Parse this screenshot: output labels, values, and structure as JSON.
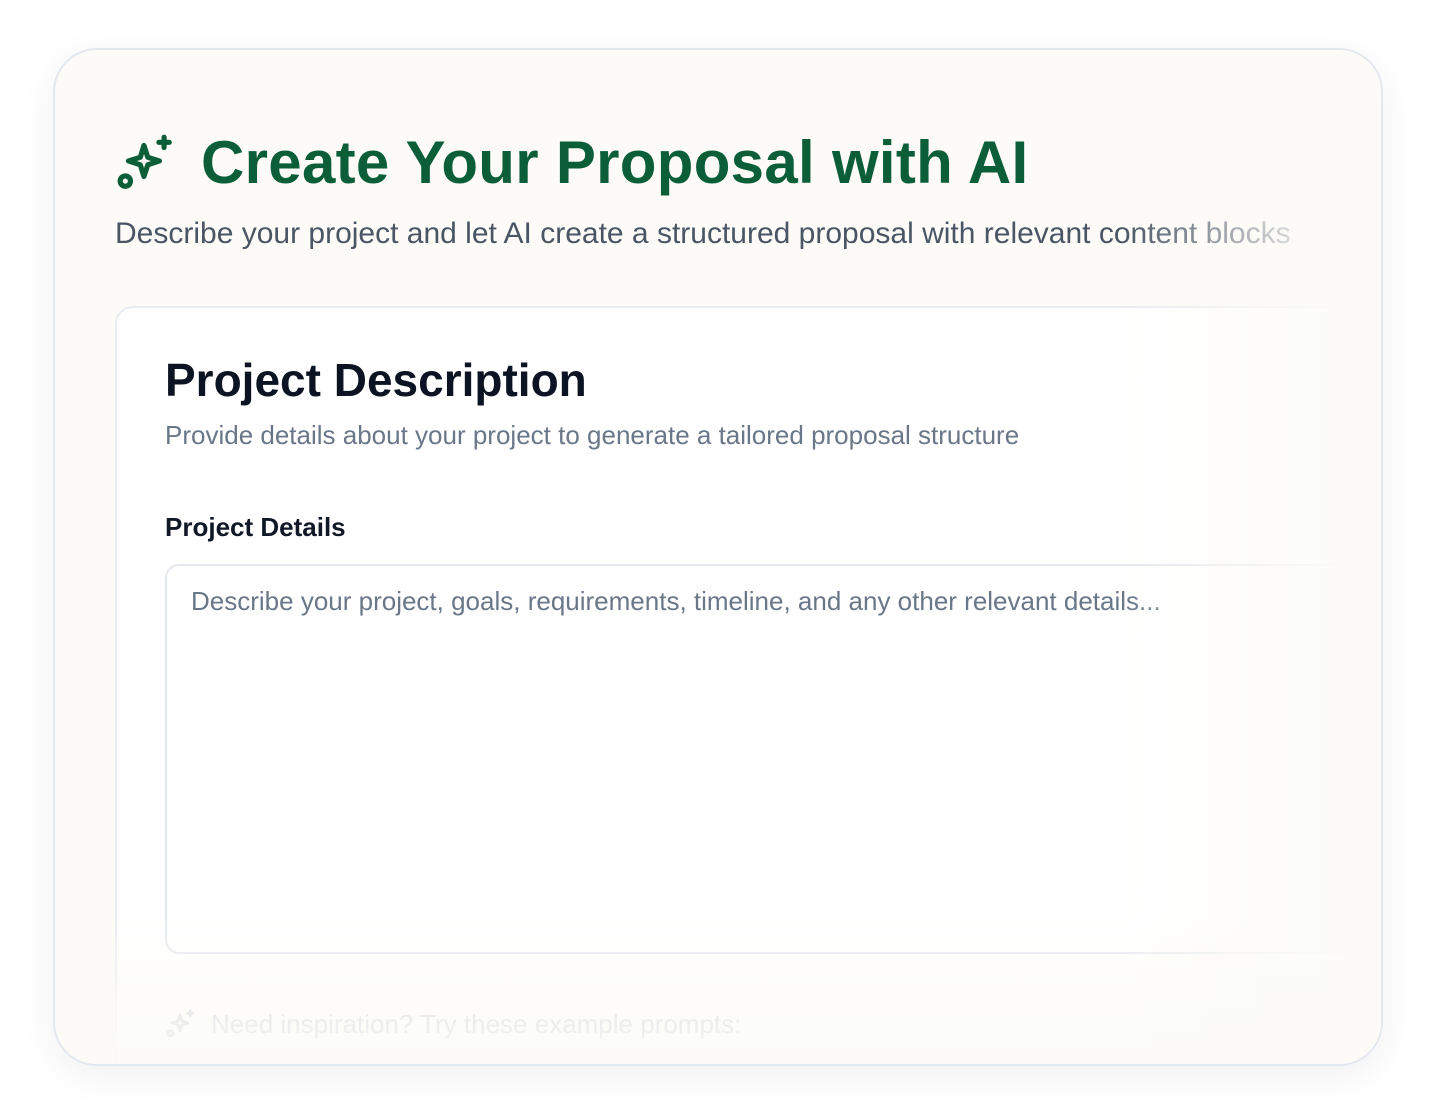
{
  "header": {
    "icon": "sparkles-icon",
    "title": "Create Your Proposal with AI",
    "subtitle": "Describe your project and let AI create a structured proposal with relevant content blocks"
  },
  "card": {
    "title": "Project Description",
    "description": "Provide details about your project to generate a tailored proposal structure",
    "field_label": "Project Details",
    "textarea": {
      "placeholder": "Describe your project, goals, requirements, timeline, and any other relevant details...",
      "value": ""
    },
    "inspiration": {
      "icon": "sparkles-icon",
      "text": "Need inspiration? Try these example prompts:"
    }
  },
  "colors": {
    "brand": "#0b5e37",
    "background": "#fcfbf7",
    "card": "#ffffff",
    "muted_text": "#6a7789",
    "border": "#e4e8ee"
  }
}
